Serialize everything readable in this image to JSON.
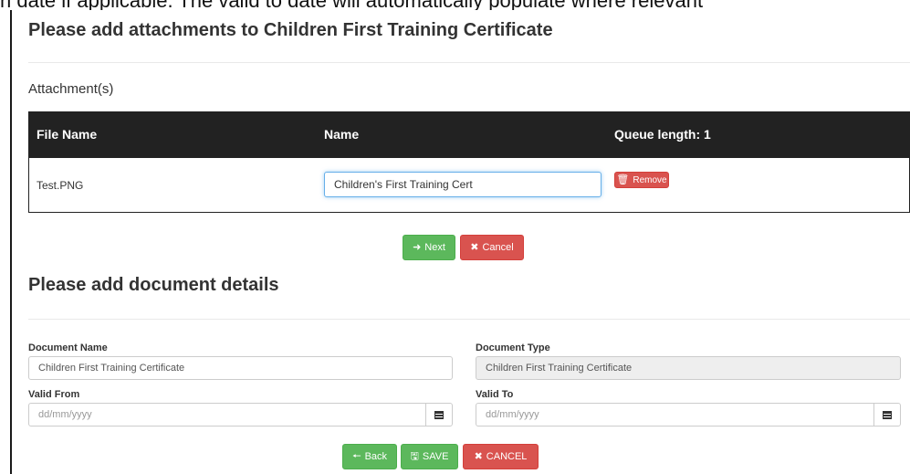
{
  "top_cut_text": "n date if applicable. The valid to date will automatically populate where relevant",
  "attachments": {
    "title": "Please add attachments to Children First Training Certificate",
    "section_label": "Attachment(s)",
    "columns": [
      "File Name",
      "Name",
      "Queue length: 1"
    ],
    "rows": [
      {
        "file_name": "Test.PNG",
        "name_value": "Children's First Training Cert",
        "remove_label": "Remove"
      }
    ],
    "next_label": "Next",
    "cancel_label": "Cancel"
  },
  "details": {
    "title": "Please add document details",
    "document_name_label": "Document Name",
    "document_name_value": "Children First Training Certificate",
    "document_type_label": "Document Type",
    "document_type_value": "Children First Training Certificate",
    "valid_from_label": "Valid From",
    "valid_from_placeholder": "dd/mm/yyyy",
    "valid_to_label": "Valid To",
    "valid_to_placeholder": "dd/mm/yyyy",
    "back_label": "Back",
    "save_label": "SAVE",
    "cancel_label": "CANCEL"
  },
  "icons": {
    "remove": "trash-icon",
    "next": "arrow-right-icon",
    "cancel": "times-icon",
    "back": "arrow-left-icon",
    "save": "floppy-disk-icon",
    "calendar": "calendar-icon"
  },
  "colors": {
    "header_bg": "#222222",
    "danger": "#d9534f",
    "success": "#5cb85c",
    "focus": "#66afe9"
  }
}
